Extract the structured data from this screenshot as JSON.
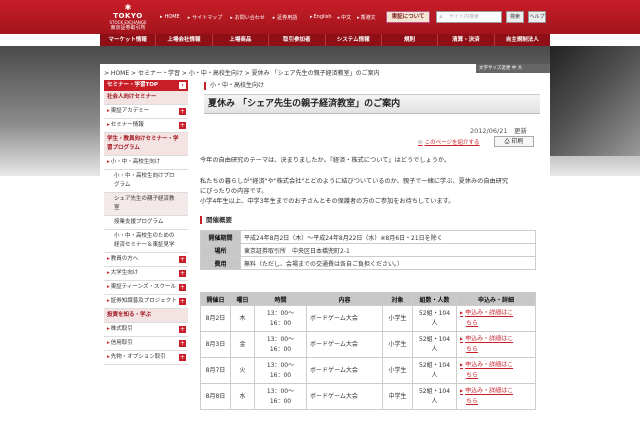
{
  "logo": {
    "mark": "✱",
    "name": "TOKYO",
    "sub": "STOCK EXCHANGE",
    "jp": "東京証券取引所"
  },
  "util_links": [
    "HOME",
    "サイトマップ",
    "お問い合わせ",
    "証券用語"
  ],
  "lang_links": [
    "English",
    "中文",
    "香港文"
  ],
  "about_btn": "東証について",
  "search": {
    "placeholder": "サイト内検索",
    "button": "検索",
    "help": "ヘルプ"
  },
  "nav": [
    "マーケット情報",
    "上場会社情報",
    "上場商品",
    "取引参加者",
    "システム情報",
    "規則",
    "清算・決済",
    "自主規制法人"
  ],
  "breadcrumb": "> HOME > セミナー・学習 > 小・中・高校生向け > 夏休み 「シェア先生の親子経済教室」のご案内",
  "lang_bar": "文字サイズ変更   中   大",
  "sidebar": {
    "top": "セミナー・学習TOP",
    "items": [
      {
        "label": "社会人向けセミナー",
        "cls": "sec",
        "plus": false
      },
      {
        "label": "東証アカデミー",
        "cls": "bullet",
        "plus": true
      },
      {
        "label": "セミナー情報",
        "cls": "bullet",
        "plus": true
      },
      {
        "label": "学生・教員向けセミナー・学習プログラム",
        "cls": "sec",
        "plus": false
      },
      {
        "label": "小・中・高校生向け",
        "cls": "bullet",
        "plus": false
      },
      {
        "label": "小・中・高校生向けプログラム",
        "cls": "sub",
        "plus": false
      },
      {
        "label": "シェア先生の親子経済教室",
        "cls": "sub active",
        "plus": false
      },
      {
        "label": "授業支援プログラム",
        "cls": "sub",
        "plus": false
      },
      {
        "label": "小・中・高校生のための経済セミナー＆東証見学",
        "cls": "sub",
        "plus": false
      },
      {
        "label": "教員の方へ",
        "cls": "bullet",
        "plus": true
      },
      {
        "label": "大学生向け",
        "cls": "bullet",
        "plus": true
      },
      {
        "label": "東証ティーンズ・スクール",
        "cls": "bullet",
        "plus": true
      },
      {
        "label": "証券知識普及プロジェクト",
        "cls": "bullet",
        "plus": true
      },
      {
        "label": "投資を知る・学ぶ",
        "cls": "sec",
        "plus": false
      },
      {
        "label": "株式取引",
        "cls": "bullet",
        "plus": true
      },
      {
        "label": "信用取引",
        "cls": "bullet",
        "plus": true
      },
      {
        "label": "先物・オプション取引",
        "cls": "bullet",
        "plus": true
      }
    ]
  },
  "main": {
    "category": "小・中・高校生向け",
    "title": "夏休み 「シェア先生の親子経済教室」のご案内",
    "date": "2012/06/21　更新",
    "link_page": "このページを紹介する",
    "print": "印刷",
    "paragraphs": [
      "今年の自由研究のテーマは、決まりましたか。『経済・株式について』はどうでしょうか。",
      "私たちの暮らしが\"経済\"や\"株式会社\"とどのように結びついているのか、親子で一緒に学ぶ、夏休みの自由研究",
      "にぴったりの内容です。",
      "小学4年生以上、中学3年生までのお子さんとその保護者の方のご参加をお待ちしています。"
    ],
    "overview_head": "開催概要",
    "overview": [
      {
        "th": "開催期間",
        "td": "平成24年8月2日（木）～平成24年8月22日（水）※8月6日・21日を除く"
      },
      {
        "th": "場所",
        "td": "東京証券取引所　中央区日本橋兜町2-1"
      },
      {
        "th": "費用",
        "td": "無料（ただし、会場までの交通費は各自ご負担ください。）"
      }
    ],
    "sched_headers": [
      "開催日",
      "曜日",
      "時間",
      "内容",
      "対象",
      "組数・人数",
      "申込み・詳細"
    ],
    "sched_rows": [
      {
        "date": "8月2日",
        "day": "木",
        "time1": "13：00～",
        "time2": "16：00",
        "event": "ボードゲーム大会",
        "target": "小学生",
        "n1": "52組・104",
        "n2": "人",
        "a1": "申込み・詳細はこ",
        "a2": "ちら"
      },
      {
        "date": "8月3日",
        "day": "金",
        "time1": "13：00～",
        "time2": "16：00",
        "event": "ボードゲーム大会",
        "target": "小学生",
        "n1": "52組・104",
        "n2": "人",
        "a1": "申込み・詳細はこ",
        "a2": "ちら"
      },
      {
        "date": "8月7日",
        "day": "火",
        "time1": "13：00～",
        "time2": "16：00",
        "event": "ボードゲーム大会",
        "target": "小学生",
        "n1": "52組・104",
        "n2": "人",
        "a1": "申込み・詳細はこ",
        "a2": "ちら"
      },
      {
        "date": "8月8日",
        "day": "水",
        "time1": "13：00～",
        "time2": "16：00",
        "event": "ボードゲーム大会",
        "target": "中学生",
        "n1": "52組・104",
        "n2": "人",
        "a1": "申込み・詳細はこ",
        "a2": "ちら"
      }
    ]
  }
}
